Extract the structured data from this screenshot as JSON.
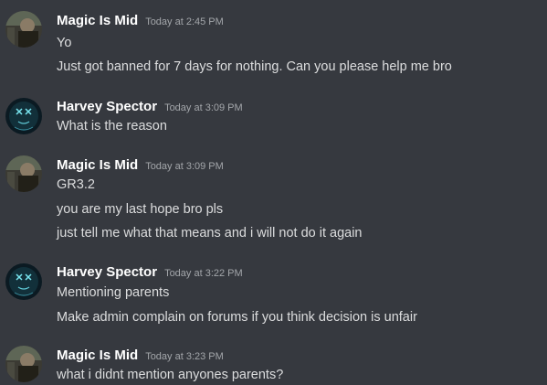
{
  "messages": [
    {
      "author": "Magic Is Mid",
      "timestamp": "Today at 2:45 PM",
      "avatar_icon": "magic-avatar-icon",
      "lines": [
        "Yo",
        "Just got banned for 7 days for nothing. Can you please help me bro"
      ]
    },
    {
      "author": "Harvey Spector",
      "timestamp": "Today at 3:09 PM",
      "avatar_icon": "harvey-avatar-icon",
      "lines": [
        "What is the reason"
      ]
    },
    {
      "author": "Magic Is Mid",
      "timestamp": "Today at 3:09 PM",
      "avatar_icon": "magic-avatar-icon",
      "lines": [
        "GR3.2",
        "you are my last hope bro pls",
        "just tell me what that means and i will not do it again"
      ]
    },
    {
      "author": "Harvey Spector",
      "timestamp": "Today at 3:22 PM",
      "avatar_icon": "harvey-avatar-icon",
      "lines": [
        "Mentioning parents",
        "Make admin complain on forums if you think decision is unfair"
      ]
    },
    {
      "author": "Magic Is Mid",
      "timestamp": "Today at 3:23 PM",
      "avatar_icon": "magic-avatar-icon",
      "lines": [
        "what i didnt mention anyones parents?"
      ]
    }
  ],
  "colors": {
    "background": "#36393f",
    "username": "#ffffff",
    "timestamp": "#a3a6aa",
    "message_text": "#dcddde"
  }
}
